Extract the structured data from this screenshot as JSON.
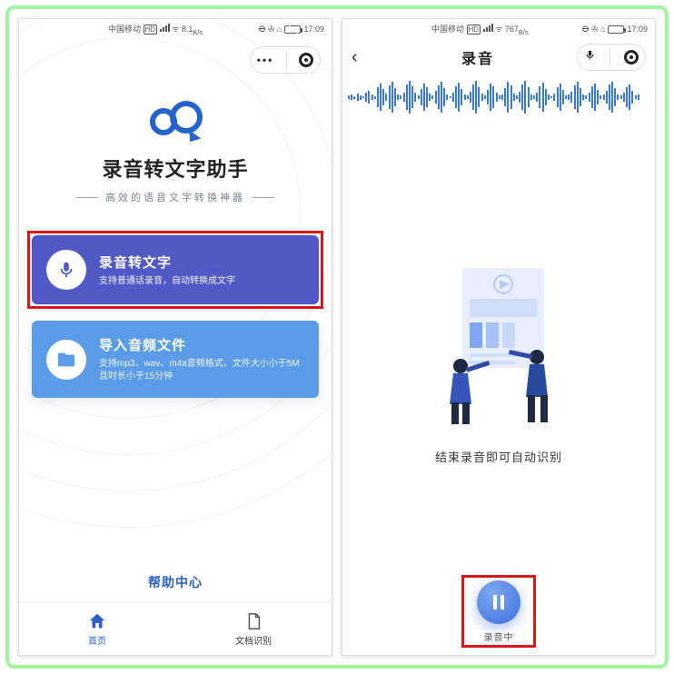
{
  "status": {
    "carrier": "中国移动",
    "hd": "HD",
    "net": "46",
    "speed_left": "8.1",
    "speed_left_unit": "K/s",
    "speed_right": "767",
    "speed_right_unit": "B/s",
    "time": "17:09"
  },
  "left": {
    "app_title": "录音转文字助手",
    "subtitle": "高效的语音文字转换神器",
    "card1": {
      "title": "录音转文字",
      "desc": "支持普通话录音，自动转换成文字"
    },
    "card2": {
      "title": "导入音频文件",
      "desc": "支持mp3、wav、m4a音频格式，文件大小小于5M且时长小于15分钟"
    },
    "help": "帮助中心",
    "tab_home": "首页",
    "tab_scan": "文档识别"
  },
  "right": {
    "title": "录音",
    "caption": "结束录音即可自动识别",
    "rec_label": "录音中"
  }
}
